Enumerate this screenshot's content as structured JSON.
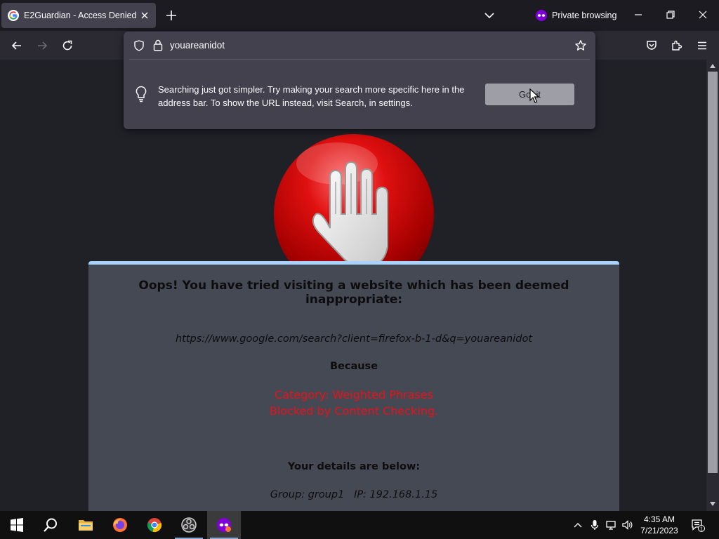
{
  "browser": {
    "tab": {
      "title": "E2Guardian - Access Denied"
    },
    "private_label": "Private browsing",
    "url": "youareanidot"
  },
  "search_tip": {
    "text": "Searching just got simpler. Try making your search more specific here in the address bar. To show the URL instead, visit Search, in settings.",
    "button_label": "Got it",
    "button_visible_text": "Go  it"
  },
  "block_page": {
    "title": "Oops! You have tried visiting a website which has been deemed inappropriate:",
    "blocked_url": "https://www.google.com/search?client=firefox-b-1-d&q=youareanidot",
    "because_label": "Because",
    "reason_line1": "Category: Weighted Phrases",
    "reason_line2": "Blocked by Content Checking.",
    "details_heading": "Your details are below:",
    "details": "Group: group1   IP: 192.168.1.15"
  },
  "taskbar": {
    "apps": [
      "start",
      "search",
      "file-explorer",
      "firefox",
      "chrome",
      "obs-studio",
      "firefox-private"
    ],
    "time": "4:35 AM",
    "date": "7/21/2023",
    "notification_count": "1"
  },
  "colors": {
    "accent": "#a9d3ff",
    "blocked_reason": "#e8111a",
    "private_purple": "#8000d7"
  }
}
